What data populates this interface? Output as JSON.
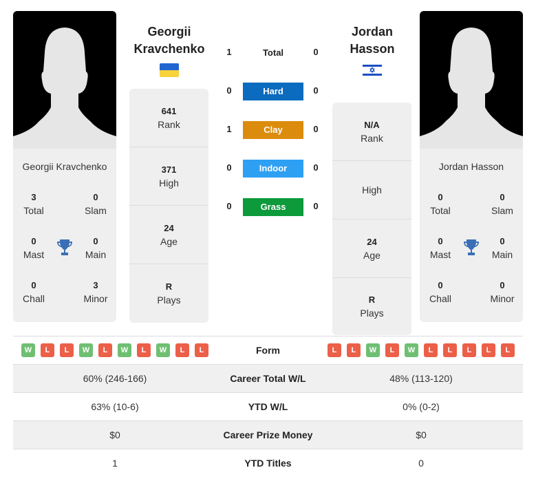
{
  "player1": {
    "name_line1": "Georgii",
    "name_line2": "Kravchenko",
    "full_name": "Georgii Kravchenko",
    "flag": "ukraine-flag",
    "info": {
      "rank_value": "641",
      "rank_label": "Rank",
      "high_value": "371",
      "high_label": "High",
      "age_value": "24",
      "age_label": "Age",
      "plays_value": "R",
      "plays_label": "Plays"
    },
    "titles": {
      "total_value": "3",
      "total_label": "Total",
      "slam_value": "0",
      "slam_label": "Slam",
      "mast_value": "0",
      "mast_label": "Mast",
      "main_value": "0",
      "main_label": "Main",
      "chall_value": "0",
      "chall_label": "Chall",
      "minor_value": "3",
      "minor_label": "Minor"
    },
    "form": [
      "W",
      "L",
      "L",
      "W",
      "L",
      "W",
      "L",
      "W",
      "L",
      "L"
    ]
  },
  "player2": {
    "name_line1": "Jordan",
    "name_line2": "Hasson",
    "full_name": "Jordan Hasson",
    "flag": "israel-flag",
    "info": {
      "rank_value": "N/A",
      "rank_label": "Rank",
      "high_value": "",
      "high_label": "High",
      "age_value": "24",
      "age_label": "Age",
      "plays_value": "R",
      "plays_label": "Plays"
    },
    "titles": {
      "total_value": "0",
      "total_label": "Total",
      "slam_value": "0",
      "slam_label": "Slam",
      "mast_value": "0",
      "mast_label": "Mast",
      "main_value": "0",
      "main_label": "Main",
      "chall_value": "0",
      "chall_label": "Chall",
      "minor_value": "0",
      "minor_label": "Minor"
    },
    "form": [
      "L",
      "L",
      "W",
      "L",
      "W",
      "L",
      "L",
      "L",
      "L",
      "L"
    ]
  },
  "h2h": {
    "total": {
      "label": "Total",
      "p1": "1",
      "p2": "0"
    },
    "surfaces": [
      {
        "label": "Hard",
        "p1": "0",
        "p2": "0",
        "color": "#0a6bbf"
      },
      {
        "label": "Clay",
        "p1": "1",
        "p2": "0",
        "color": "#dc8c0c"
      },
      {
        "label": "Indoor",
        "p1": "0",
        "p2": "0",
        "color": "#2ea0f3"
      },
      {
        "label": "Grass",
        "p1": "0",
        "p2": "0",
        "color": "#0c9a3a"
      }
    ]
  },
  "comparison": {
    "form_label": "Form",
    "rows": [
      {
        "label": "Career Total W/L",
        "p1": "60% (246-166)",
        "p2": "48% (113-120)"
      },
      {
        "label": "YTD W/L",
        "p1": "63% (10-6)",
        "p2": "0% (0-2)"
      },
      {
        "label": "Career Prize Money",
        "p1": "$0",
        "p2": "$0"
      },
      {
        "label": "YTD Titles",
        "p1": "1",
        "p2": "0"
      }
    ]
  }
}
